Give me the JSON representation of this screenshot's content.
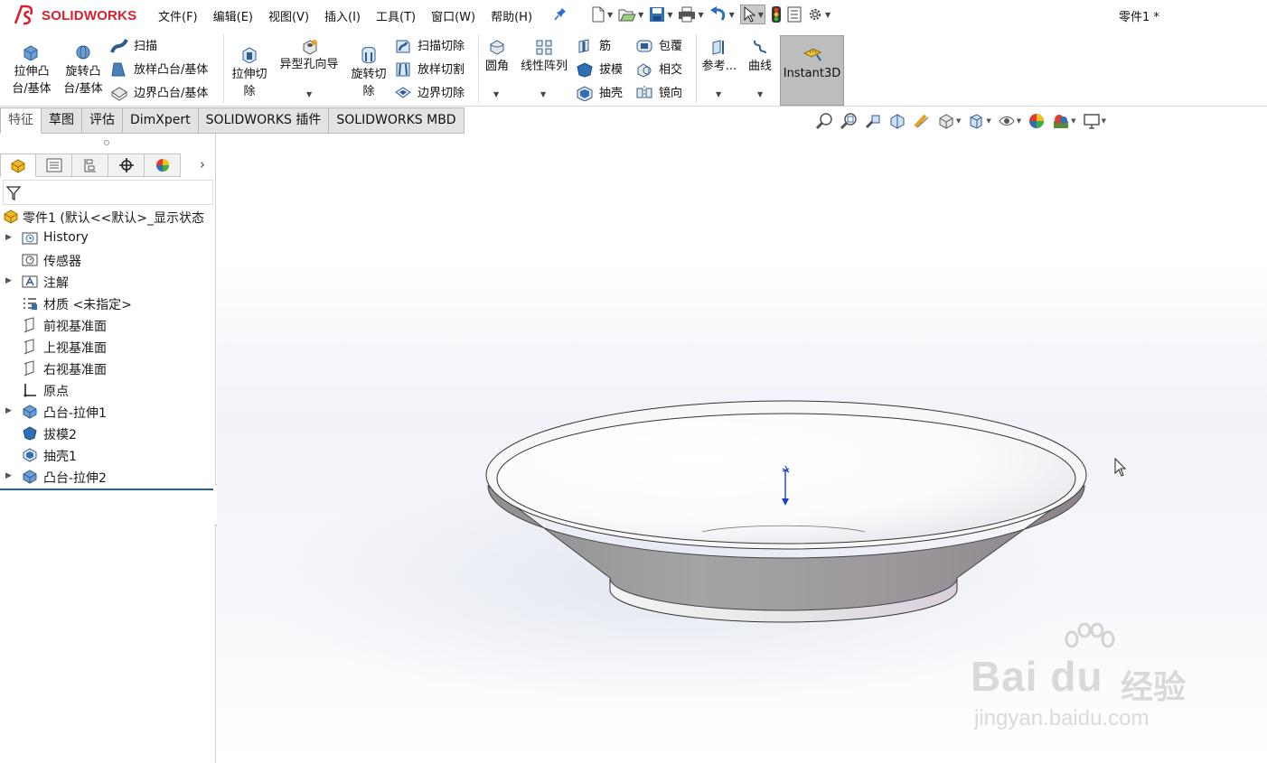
{
  "app": {
    "brand": "SOLIDWORKS",
    "document_title": "零件1 *"
  },
  "menus": [
    "文件(F)",
    "编辑(E)",
    "视图(V)",
    "插入(I)",
    "工具(T)",
    "窗口(W)",
    "帮助(H)"
  ],
  "quick_toolbar": [
    "new-document-icon",
    "open-icon",
    "save-icon",
    "print-icon",
    "undo-icon",
    "select-icon",
    "rebuild-icon",
    "file-properties-icon",
    "options-icon"
  ],
  "ribbon": {
    "extruded_boss": [
      "拉伸凸",
      "台/基体"
    ],
    "revolved_boss": [
      "旋转凸",
      "台/基体"
    ],
    "sweep": "扫描",
    "loft_boss": "放样凸台/基体",
    "boundary_boss": "边界凸台/基体",
    "extruded_cut": [
      "拉伸切",
      "除"
    ],
    "hole_wizard": "异型孔向导",
    "revolved_cut": [
      "旋转切",
      "除"
    ],
    "swept_cut": "扫描切除",
    "lofted_cut": "放样切割",
    "boundary_cut": "边界切除",
    "fillet": "圆角",
    "linear_pattern": "线性阵列",
    "rib": "筋",
    "draft": "拔模",
    "shell": "抽壳",
    "wrap": "包覆",
    "intersect": "相交",
    "mirror": "镜向",
    "reference": "参考...",
    "curves": "曲线",
    "instant3d": "Instant3D"
  },
  "tabs": [
    "特征",
    "草图",
    "评估",
    "DimXpert",
    "SOLIDWORKS 插件",
    "SOLIDWORKS MBD"
  ],
  "active_tab": "特征",
  "panel_tabs": [
    "feature-manager-icon",
    "property-manager-icon",
    "configuration-manager-icon",
    "dimxpert-manager-icon",
    "display-manager-icon"
  ],
  "tree": {
    "root": "零件1  (默认<<默认>_显示状态",
    "items": [
      {
        "label": "History",
        "icon": "history-folder-icon",
        "expandable": true
      },
      {
        "label": "传感器",
        "icon": "sensors-icon",
        "expandable": false
      },
      {
        "label": "注解",
        "icon": "annotations-icon",
        "expandable": true
      },
      {
        "label": "材质 <未指定>",
        "icon": "material-icon",
        "expandable": false
      },
      {
        "label": "前视基准面",
        "icon": "plane-icon",
        "expandable": false
      },
      {
        "label": "上视基准面",
        "icon": "plane-icon",
        "expandable": false
      },
      {
        "label": "右视基准面",
        "icon": "plane-icon",
        "expandable": false
      },
      {
        "label": "原点",
        "icon": "origin-icon",
        "expandable": false
      },
      {
        "label": "凸台-拉伸1",
        "icon": "boss-extrude-icon",
        "expandable": true
      },
      {
        "label": "拔模2",
        "icon": "draft-icon",
        "expandable": false
      },
      {
        "label": "抽壳1",
        "icon": "shell-icon",
        "expandable": false
      },
      {
        "label": "凸台-拉伸2",
        "icon": "boss-extrude-icon",
        "expandable": true
      }
    ]
  },
  "watermark": {
    "brand": "Bai du",
    "cn": "经验",
    "url": "jingyan.baidu.com"
  },
  "colors": {
    "brand_red": "#d8202f",
    "rollback_bar": "#1c5fbd",
    "model_gray": "#9e9e9e",
    "active_button": "#bdbdbd"
  }
}
